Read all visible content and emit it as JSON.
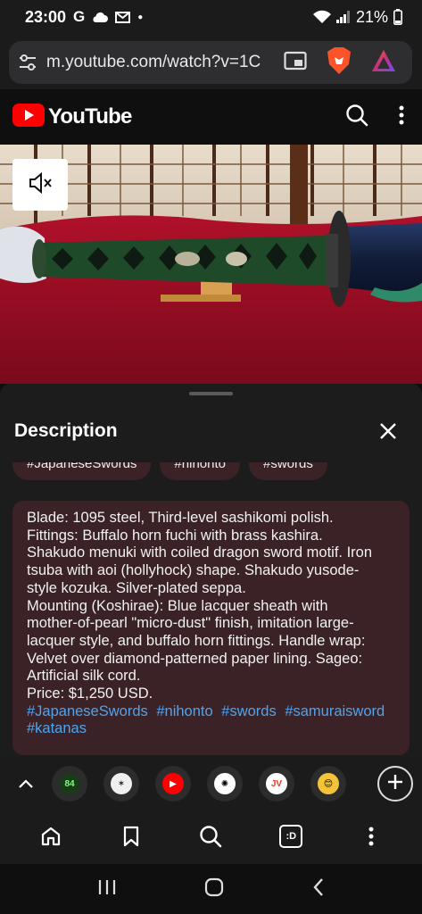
{
  "status_bar": {
    "time": "23:00",
    "notif_icons": [
      "google-g-icon",
      "cloud-icon",
      "gmail-icon",
      "dot-icon"
    ],
    "battery": "21%"
  },
  "browser": {
    "url": "m.youtube.com/watch?v=1C",
    "icons": [
      "tune-icon",
      "picture-in-picture-icon",
      "brave-lion-icon",
      "brave-rewards-icon"
    ]
  },
  "youtube": {
    "logo_text": "YouTube",
    "icons": [
      "search-icon",
      "more-vertical-icon"
    ]
  },
  "video": {
    "mute_icon": "volume-off-icon"
  },
  "description": {
    "title": "Description",
    "close_icon": "close-icon",
    "chips": [
      "#JapaneseSwords",
      "#nihonto",
      "#swords"
    ],
    "lines": [
      "Blade: 1095 steel, Third-level sashikomi polish.",
      "Fittings: Buffalo horn fuchi with brass kashira.",
      "Shakudo menuki with coiled dragon sword motif. Iron",
      "tsuba with aoi (hollyhock) shape. Shakudo yusode-",
      "style kozuka. Silver-plated seppa.",
      "Mounting (Koshirae): Blue lacquer sheath with",
      "mother-of-pearl \"micro-dust\" finish, imitation large-",
      "lacquer style, and buffalo horn fittings. Handle wrap:",
      "Velvet over diamond-patterned paper lining. Sageo:",
      "Artificial silk cord.",
      "Price: $1,250 USD."
    ],
    "hashtags_line1": [
      "#JapaneseSwords",
      "#nihonto",
      "#swords",
      "#samuraisword"
    ],
    "hashtags_line2": [
      "#katanas"
    ]
  },
  "tab_strip": {
    "tabs": [
      {
        "name": "tab-scoreboard",
        "label": "84",
        "bg": "#1a3a1a",
        "fg": "#7fff7f"
      },
      {
        "name": "tab-stamp",
        "label": "✶",
        "bg": "#f0f0f0",
        "fg": "#222"
      },
      {
        "name": "tab-youtube",
        "label": "▶",
        "bg": "#ff0000",
        "fg": "#fff"
      },
      {
        "name": "tab-openai",
        "label": "✺",
        "bg": "#ffffff",
        "fg": "#000"
      },
      {
        "name": "tab-jv",
        "label": "JV",
        "bg": "#ffffff",
        "fg": "#e63a2e"
      },
      {
        "name": "tab-emoji",
        "label": "😊",
        "bg": "#f3c33a",
        "fg": "#000"
      }
    ]
  },
  "toolbar": {
    "icons": [
      "home-icon",
      "bookmark-icon",
      "search-icon",
      "tab-count-icon",
      "more-vertical-icon"
    ],
    "tab_label": ":D"
  },
  "android_nav": {
    "icons": [
      "recents-icon",
      "home-circle-icon",
      "back-icon"
    ]
  },
  "colors": {
    "accent_red": "#ff0000",
    "link_blue": "#4ea4f0",
    "desc_bg": "#3a2226"
  }
}
